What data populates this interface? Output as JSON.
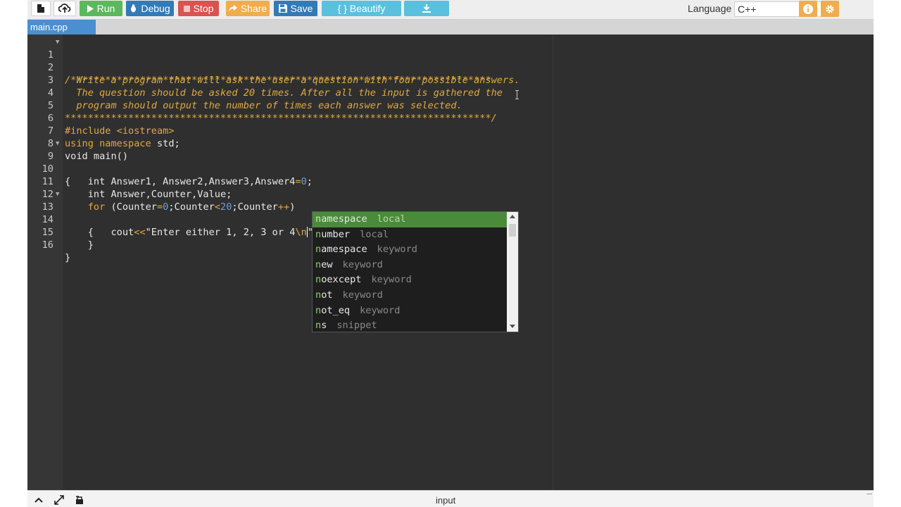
{
  "toolbar": {
    "run_label": "Run",
    "debug_label": "Debug",
    "stop_label": "Stop",
    "share_label": "Share",
    "save_label": "Save",
    "beautify_label": "{ } Beautify",
    "language_label": "Language",
    "language_value": "C++",
    "icons": [
      "new-file-icon",
      "upload-icon",
      "play-icon",
      "bug-icon",
      "stop-icon",
      "share-icon",
      "floppy-icon",
      "download-icon",
      "info-icon",
      "gear-icon"
    ],
    "colors": {
      "run": "#5cb85c",
      "debug": "#337ab7",
      "stop": "#d9534f",
      "share": "#f0ad4e",
      "save": "#337ab7",
      "beautify": "#5bc0de",
      "download": "#5bc0de",
      "info": "#f0ad4e",
      "settings": "#f0ad4e"
    }
  },
  "tabs": {
    "active_file": "main.cpp"
  },
  "editor": {
    "line_numbers": [
      "1",
      "2",
      "3",
      "4",
      "5",
      "6",
      "7",
      "8",
      "9",
      "10",
      "11",
      "12",
      "13",
      "14",
      "15",
      "16"
    ],
    "lines": {
      "l1": "/*************************************************************************",
      "l2": "  Write a program that will ask the user a question with four possible answers.",
      "l3": "  The question should be asked 20 times. After all the input is gathered the",
      "l4": "  program should output the number of times each answer was selected.",
      "l5": "**************************************************************************/",
      "l6_a": "#include ",
      "l6_b": "<iostream>",
      "l7_a": "using namespace",
      "l7_b": " std;",
      "l8": "void main()",
      "l9": "{",
      "l10_a": "    int Answer1, Answer2,Answer3,Answer4",
      "l10_b": "=",
      "l10_c": "0",
      "l10_d": ";",
      "l11": "    int Answer,Counter,Value;",
      "l12_a": "    for",
      "l12_b": " (Counter",
      "l12_c": "=",
      "l12_d": "0",
      "l12_e": ";Counter",
      "l12_f": "<",
      "l12_g": "20",
      "l12_h": ";Counter",
      "l12_i": "++",
      "l12_j": ")",
      "l13": "    {",
      "l14_a": "        cout",
      "l14_b": "<<",
      "l14_c": "\"Enter either 1, 2, 3 or 4",
      "l14_d": "\\n",
      "l14_e": "\"",
      "l15": "    }",
      "l16": "}"
    }
  },
  "autocomplete": {
    "items": [
      {
        "match": "n",
        "rest": "amespace",
        "meta": "local"
      },
      {
        "match": "n",
        "rest": "umber",
        "meta": "local"
      },
      {
        "match": "n",
        "rest": "amespace",
        "meta": "keyword"
      },
      {
        "match": "n",
        "rest": "ew",
        "meta": "keyword"
      },
      {
        "match": "n",
        "rest": "oexcept",
        "meta": "keyword"
      },
      {
        "match": "n",
        "rest": "ot",
        "meta": "keyword"
      },
      {
        "match": "n",
        "rest": "ot_eq",
        "meta": "keyword"
      },
      {
        "match": "n",
        "rest": "s",
        "meta": "snippet"
      }
    ],
    "selected_index": 0
  },
  "bottombar": {
    "label": "input",
    "icons": [
      "chevron-up-icon",
      "expand-icon",
      "stdin-icon"
    ]
  }
}
